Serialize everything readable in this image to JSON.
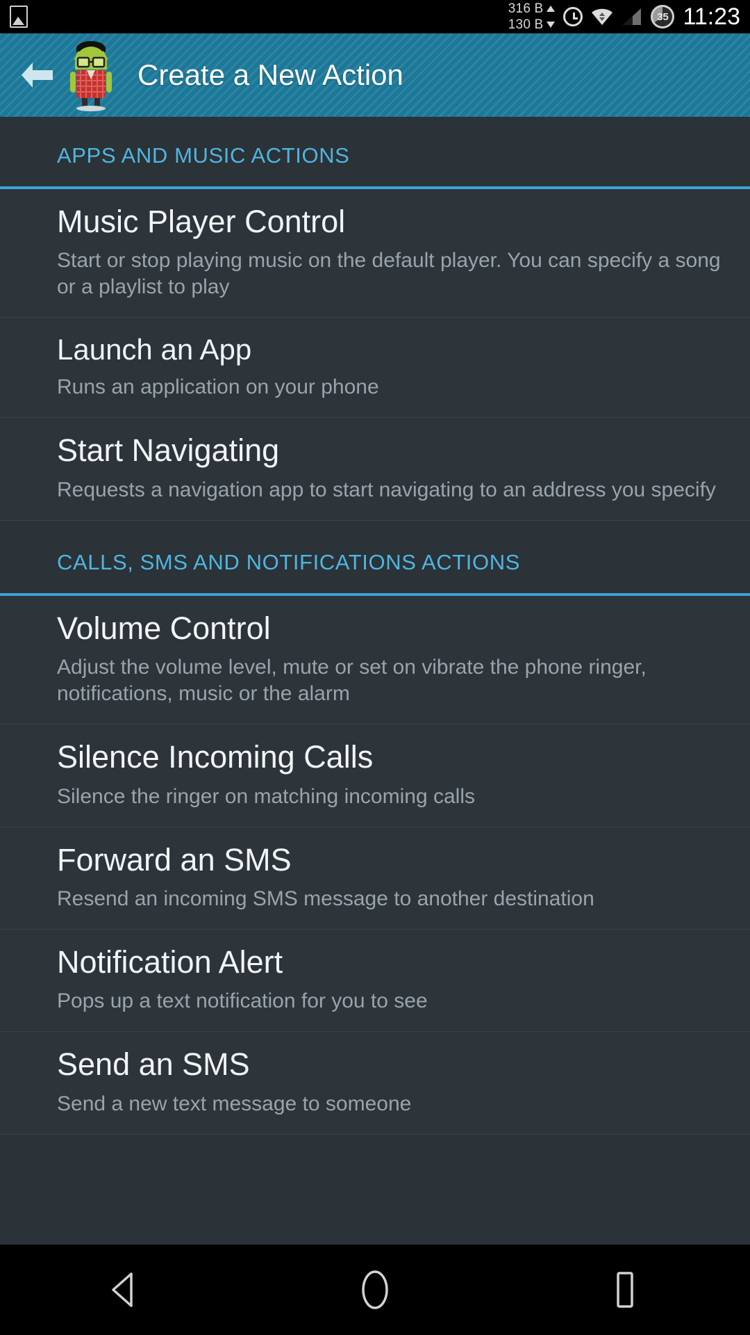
{
  "status_bar": {
    "notification_icon": "gallery-icon",
    "net_up": "316 B",
    "net_down": "130 B",
    "alarm_icon": "alarm-icon",
    "wifi_icon": "wifi-icon",
    "signal_icon": "cell-signal-icon",
    "battery_level": "35",
    "clock": "11:23"
  },
  "action_bar": {
    "back_icon": "back-arrow-icon",
    "app_icon": "android-hipster-mascot-icon",
    "title": "Create a New Action",
    "bg_color": "#1b7898"
  },
  "accent_color": "#4fb6e0",
  "sections": [
    {
      "header": "APPS AND MUSIC ACTIONS",
      "items": [
        {
          "title": "Music Player Control",
          "desc": "Start or stop playing music on the default player. You can specify a song or a playlist to play"
        },
        {
          "title": "Launch an App",
          "desc": "Runs an application on your phone"
        },
        {
          "title": "Start Navigating",
          "desc": "Requests a navigation app to start navigating to an address you specify"
        }
      ]
    },
    {
      "header": "CALLS, SMS AND NOTIFICATIONS ACTIONS",
      "items": [
        {
          "title": "Volume Control",
          "desc": "Adjust the volume level, mute or set on vibrate the phone ringer, notifications, music or the alarm"
        },
        {
          "title": "Silence Incoming Calls",
          "desc": "Silence the ringer on matching incoming calls"
        },
        {
          "title": "Forward an SMS",
          "desc": "Resend an incoming SMS message to another destination"
        },
        {
          "title": "Notification Alert",
          "desc": "Pops up a text notification for you to see"
        },
        {
          "title": "Send an SMS",
          "desc": "Send a new text message to someone"
        }
      ]
    }
  ],
  "nav_bar": {
    "back": "nav-back-icon",
    "home": "nav-home-icon",
    "recents": "nav-recents-icon"
  }
}
